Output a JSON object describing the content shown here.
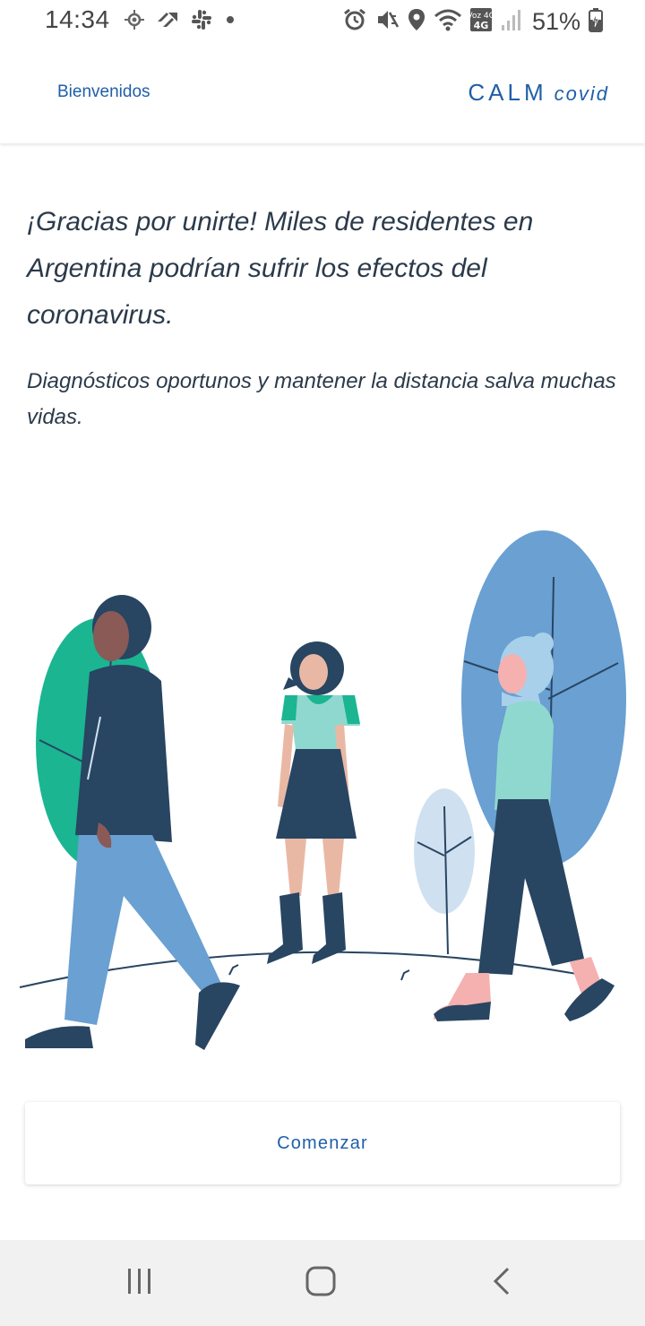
{
  "status_bar": {
    "time": "14:34",
    "battery": "51%",
    "network_label": "Voz 4G",
    "left_icons": [
      "location-target-icon",
      "jira-icon",
      "slack-icon",
      "dot-icon"
    ],
    "right_icons": [
      "alarm-icon",
      "mute-vibrate-icon",
      "location-pin-icon",
      "wifi-icon",
      "volte-4g-icon",
      "signal-icon",
      "battery-charging-icon"
    ]
  },
  "header": {
    "page_label": "Bienvenidos",
    "brand_main": "CALM",
    "brand_sub": "covid"
  },
  "content": {
    "headline": "¡Gracias por unirte! Miles de residentes en Argentina podrían sufrir los efectos del coronavirus.",
    "subline": "Diagnósticos oportunos y mantener la distancia salva muchas vidas."
  },
  "actions": {
    "start_label": "Comenzar"
  },
  "nav_bar": {
    "icons": [
      "recent-apps-icon",
      "home-icon",
      "back-icon"
    ]
  },
  "colors": {
    "accent": "#1f5fa8",
    "text": "#2b3a4a",
    "navy": "#284562",
    "teal": "#1bb592",
    "mint": "#8fd8cf",
    "sky": "#6aa0d2",
    "pale_blue": "#cfe1f0",
    "skin": "#e9b8a4",
    "pink": "#f5b0b0"
  }
}
